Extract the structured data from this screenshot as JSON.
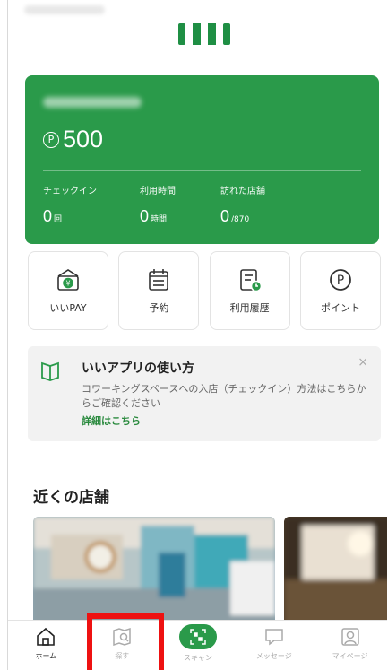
{
  "brand": {
    "accent": "#2a9a4a",
    "highlight": "#ee1111"
  },
  "card": {
    "balance": "500",
    "point_symbol": "P",
    "stats": [
      {
        "label": "チェックイン",
        "value": "0",
        "unit": "回"
      },
      {
        "label": "利用時間",
        "value": "0",
        "unit": "時間"
      },
      {
        "label": "訪れた店舗",
        "value": "0",
        "unit": "/870"
      }
    ]
  },
  "actions": [
    {
      "label": "いいPAY",
      "icon": "wallet-icon"
    },
    {
      "label": "予約",
      "icon": "calendar-icon"
    },
    {
      "label": "利用履歴",
      "icon": "history-icon"
    },
    {
      "label": "ポイント",
      "icon": "point-icon"
    }
  ],
  "notice": {
    "title": "いいアプリの使い方",
    "body": "コワーキングスペースへの入店（チェックイン）方法はこちらからご確認ください",
    "link": "詳細はこちら",
    "close": "×"
  },
  "section": {
    "nearby_title": "近くの店舗"
  },
  "tabbar": [
    {
      "label": "ホーム",
      "icon": "home-icon"
    },
    {
      "label": "探す",
      "icon": "map-search-icon"
    },
    {
      "label": "スキャン",
      "icon": "qr-scan-icon"
    },
    {
      "label": "メッセージ",
      "icon": "message-icon"
    },
    {
      "label": "マイページ",
      "icon": "profile-icon"
    }
  ]
}
